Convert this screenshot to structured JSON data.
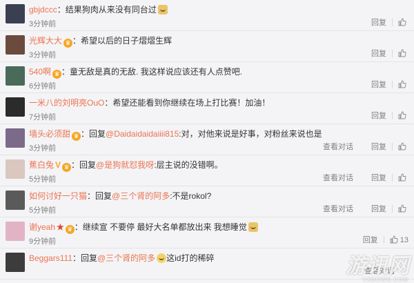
{
  "colors": {
    "username": "#eb7350",
    "meta": "#808080",
    "background": "#f4f4f6"
  },
  "comments": [
    {
      "name": "gbjdccc",
      "text": "：结果狗肉从来没有同台过",
      "time": "3分钟前",
      "reply": "回复",
      "likes": "",
      "avatar": "#3a3f52",
      "emoji": "doge"
    },
    {
      "name": "光辉大大",
      "badge": "vip",
      "text": "：希望以后的日子熠熠生辉",
      "time": "3分钟前",
      "reply": "回复",
      "likes": "",
      "avatar": "#6b4b3e"
    },
    {
      "name": "540啊",
      "badge": "vip",
      "text": "：童无敌是真的无敌. 我这样说应该还有人点赞吧.",
      "time": "6分钟前",
      "reply": "回复",
      "likes": "",
      "avatar": "#4a6a5a"
    },
    {
      "name": "一米八的刘明亮OuO",
      "text": "：希望还能看到你继续在场上打比赛！加油！",
      "time": "7分钟前",
      "reply": "回复",
      "likes": "",
      "avatar": "#2b2b2b"
    },
    {
      "name": "墙头必须甜",
      "badge": "vip",
      "pre": "：回复",
      "mention": "@Daidaidaidaiiii815",
      "text": ":对，对他来说是好事，对粉丝来说也是",
      "time": "3分钟前",
      "view": "查看对话",
      "reply": "回复",
      "likes": "",
      "avatar": "#7b6a8a"
    },
    {
      "name": "蕉白兔",
      "badge": "v-vip",
      "pre": "：回复",
      "mention": "@是狗就怼我呀",
      "text": ":层主说的没错啊。",
      "time": "5分钟前",
      "view": "查看对话",
      "reply": "回复",
      "likes": "",
      "avatar": "#d9c7c0"
    },
    {
      "name": "如何讨好一只猫",
      "pre": "：回复",
      "mention": "@三个肾的阿多",
      "text": ":不是rokol?",
      "time": "5分钟前",
      "view": "查看对话",
      "reply": "回复",
      "likes": "",
      "avatar": "#5a5a5a"
    },
    {
      "name": "谢yeah",
      "badge": "star-vip",
      "text": "：继续宣 不要停 最好大名单都放出来 我想睡觉",
      "time": "9分钟前",
      "reply": "回复",
      "likes": "13",
      "avatar": "#e2b3c4",
      "emoji": "doge"
    },
    {
      "name": "Beggars111",
      "pre": "：回复",
      "mention": "@三个肾的阿多",
      "text": "这id打的稀碎",
      "time": "",
      "view": "查看对话",
      "reply": "",
      "likes": "",
      "avatar": "#3c3c3c",
      "emoji": "cat"
    }
  ],
  "watermark": {
    "main": "游讯网",
    "sub": "YXDOWN.COM"
  }
}
